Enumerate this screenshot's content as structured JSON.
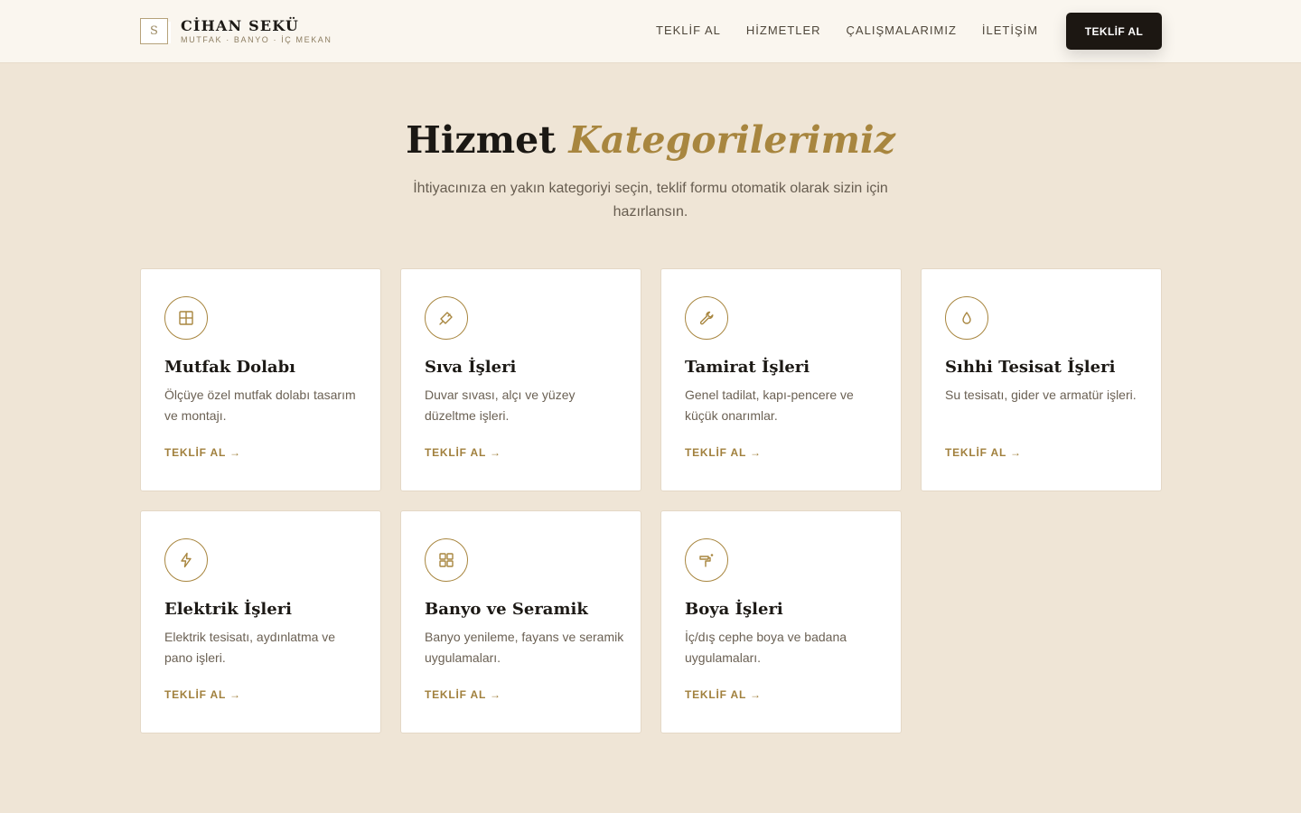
{
  "header": {
    "brand_initial": "S",
    "brand_name": "CİHAN SEKÜ",
    "brand_tagline": "MUTFAK · BANYO · İÇ MEKAN",
    "nav": [
      "TEKLİF AL",
      "HİZMETLER",
      "ÇALIŞMALARIMIZ",
      "İLETİŞİM"
    ],
    "cta_label": "TEKLİF AL"
  },
  "section": {
    "title_main": "Hizmet",
    "title_accent": "Kategorilerimiz",
    "subtitle": "İhtiyacınıza en yakın kategoriyi seçin, teklif formu otomatik olarak sizin için hazırlansın."
  },
  "cards": [
    {
      "title": "Mutfak Dolabı",
      "desc": "Ölçüye özel mutfak dolabı tasarım ve montajı.",
      "link": "TEKLİF AL →",
      "icon": "cabinet-icon"
    },
    {
      "title": "Sıva İşleri",
      "desc": "Duvar sıvası, alçı ve yüzey düzeltme işleri.",
      "link": "TEKLİF AL →",
      "icon": "trowel-icon"
    },
    {
      "title": "Tamirat İşleri",
      "desc": "Genel tadilat, kapı-pencere ve küçük onarımlar.",
      "link": "TEKLİF AL →",
      "icon": "wrench-icon"
    },
    {
      "title": "Sıhhi Tesisat İşleri",
      "desc": "Su tesisatı, gider ve armatür işleri.",
      "link": "TEKLİF AL →",
      "icon": "water-drop-icon"
    },
    {
      "title": "Elektrik İşleri",
      "desc": "Elektrik tesisatı, aydınlatma ve pano işleri.",
      "link": "TEKLİF AL →",
      "icon": "lightning-icon"
    },
    {
      "title": "Banyo ve Seramik",
      "desc": "Banyo yenileme, fayans ve seramik uygulamaları.",
      "link": "TEKLİF AL →",
      "icon": "tiles-icon"
    },
    {
      "title": "Boya İşleri",
      "desc": "İç/dış cephe boya ve badana uygulamaları.",
      "link": "TEKLİF AL →",
      "icon": "paint-roller-icon"
    }
  ],
  "colors": {
    "background": "#efe5d6",
    "accent": "#a8863f",
    "dark": "#1c1712"
  }
}
